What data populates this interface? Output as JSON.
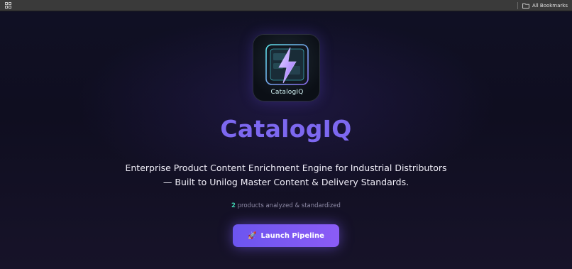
{
  "bookmarks_bar": {
    "apps_icon": "apps-grid-icon",
    "all_bookmarks_label": "All Bookmarks",
    "folder_icon": "folder-icon"
  },
  "hero": {
    "logo_caption": "CatalogIQ",
    "logo_icon": "lightning-bolt-icon",
    "title": "CatalogIQ",
    "tagline_line1": "Enterprise Product Content Enrichment Engine for Industrial Distributors",
    "tagline_line2": "— Built to Unilog Master Content & Delivery Standards.",
    "stats": {
      "count": "2",
      "text": " products analyzed & standardized"
    },
    "launch_button": {
      "icon": "rocket-icon",
      "label": "Launch Pipeline"
    }
  },
  "colors": {
    "background": "#0e0d1f",
    "title": "#7d68f0",
    "accent_count": "#3fd3b0",
    "button_start": "#6c55ef",
    "button_end": "#8b5cf6"
  }
}
